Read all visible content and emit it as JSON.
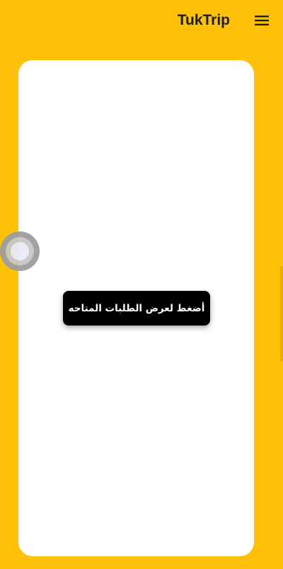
{
  "header": {
    "app_title": "TukTrip",
    "menu_icon": "hamburger-menu-icon"
  },
  "main": {
    "show_requests_label": "أضغط لعرض الطلبات المتاحه"
  },
  "overlay": {
    "bubble_icon": "floating-bubble-icon"
  },
  "colors": {
    "background": "#FFC107",
    "card": "#FFFFFF",
    "button": "#000000",
    "button_text": "#FFFFFF",
    "title_text": "#1F1F1F"
  }
}
